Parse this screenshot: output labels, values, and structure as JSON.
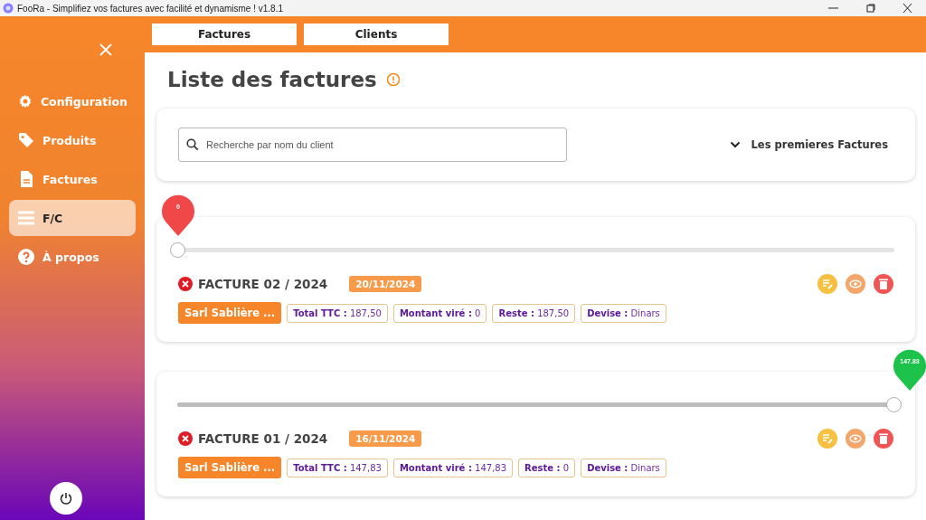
{
  "window": {
    "title": "FooRa - Simplifiez vos factures avec facilité et dynamisme ! v1.8.1"
  },
  "tabs": [
    {
      "label": "Factures"
    },
    {
      "label": "Clients"
    }
  ],
  "sidebar": {
    "items": [
      {
        "label": "Configuration",
        "kind": "gear",
        "selected": false
      },
      {
        "label": "Produits",
        "kind": "tag",
        "selected": false
      },
      {
        "label": "Factures",
        "kind": "file",
        "selected": false
      },
      {
        "label": "F/C",
        "kind": "list",
        "selected": true
      },
      {
        "label": "À propos",
        "kind": "help",
        "selected": false
      }
    ]
  },
  "heading": "Liste des factures",
  "search": {
    "placeholder": "Recherche par nom du client"
  },
  "sort": {
    "label": "Les premieres Factures"
  },
  "invoices": [
    {
      "slider": {
        "level": 0,
        "reading": "0",
        "color": "#f04848"
      },
      "title": "FACTURE 02 / 2024",
      "date": "20/11/2024",
      "client": "Sarl Sablière ...",
      "fields": [
        {
          "label": "Total TTC :",
          "value": "187,50"
        },
        {
          "label": "Montant viré :",
          "value": "0"
        },
        {
          "label": "Reste :",
          "value": "187,50"
        },
        {
          "label": "Devise :",
          "value": "Dinars"
        }
      ]
    },
    {
      "slider": {
        "level": 1,
        "reading": "147.83",
        "color": "#1cc24a"
      },
      "title": "FACTURE 01 / 2024",
      "date": "16/11/2024",
      "client": "Sarl Sablière ...",
      "fields": [
        {
          "label": "Total TTC :",
          "value": "147,83"
        },
        {
          "label": "Montant viré :",
          "value": "147,83"
        },
        {
          "label": "Reste :",
          "value": "0"
        },
        {
          "label": "Devise :",
          "value": "Dinars"
        }
      ]
    }
  ]
}
